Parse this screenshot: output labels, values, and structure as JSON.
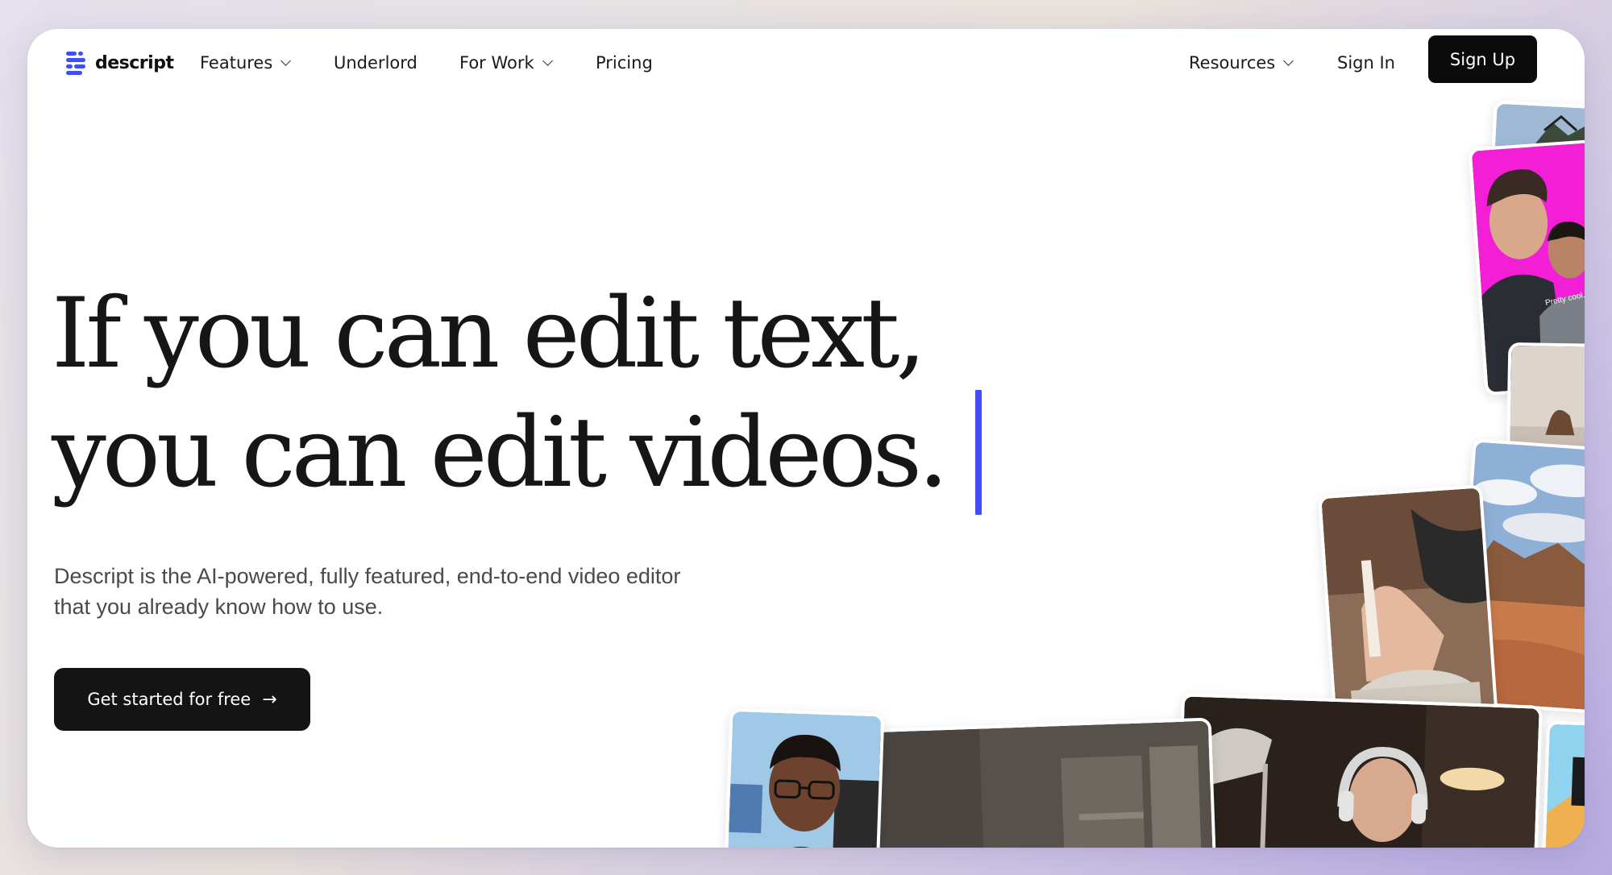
{
  "nav": {
    "brand": "descript",
    "items": [
      {
        "label": "Features",
        "dropdown": true
      },
      {
        "label": "Underlord",
        "dropdown": false
      },
      {
        "label": "For Work",
        "dropdown": true
      },
      {
        "label": "Pricing",
        "dropdown": false
      }
    ],
    "resources_label": "Resources",
    "signin_label": "Sign In",
    "signup_label": "Sign Up"
  },
  "hero": {
    "headline_line1": "If you can edit text,",
    "headline_line2": "you can edit videos.",
    "subtext_line1": "Descript is the AI-powered, fully featured, end-to-end video editor",
    "subtext_line2": "that you already know how to use.",
    "cta_label": "Get started for free",
    "cta_arrow": "→"
  },
  "thumbnails": {
    "tshirt_text": "Pretty cool."
  },
  "colors": {
    "accent": "#3f4ff2",
    "button_dark": "#0b0b0b",
    "magenta": "#f21fd6"
  }
}
